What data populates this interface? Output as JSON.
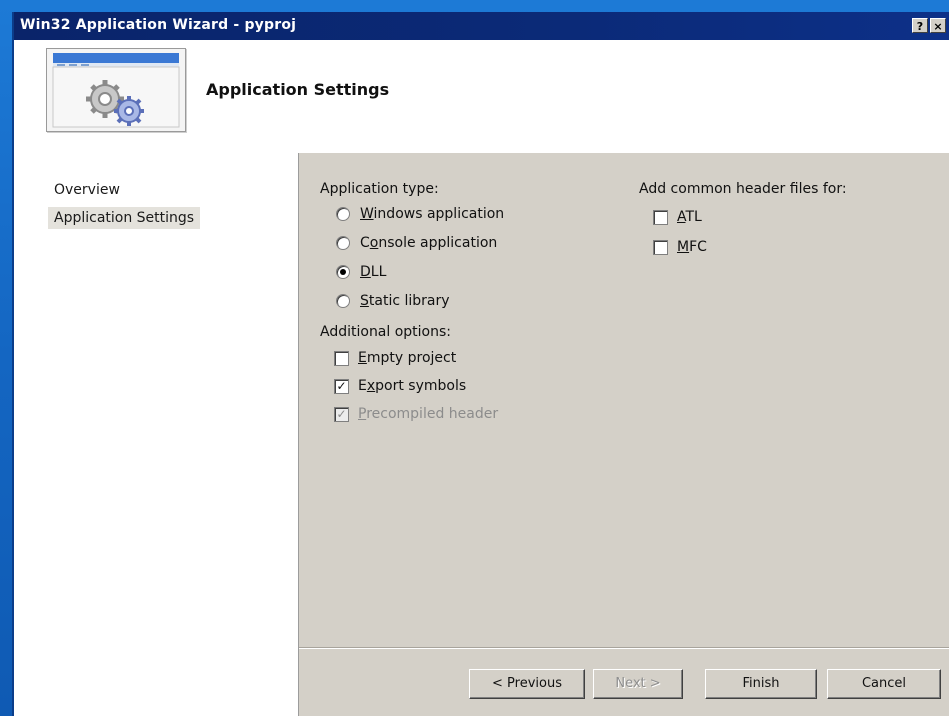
{
  "window": {
    "title": "Win32 Application Wizard - pyproj",
    "help_label": "?",
    "close_label": "×"
  },
  "header": {
    "title": "Application Settings",
    "icon": "gears-icon"
  },
  "nav": {
    "items": [
      {
        "label": "Overview",
        "selected": false
      },
      {
        "label": "Application Settings",
        "selected": true
      }
    ]
  },
  "application_type": {
    "label": "Application type:",
    "options": [
      {
        "label": "Windows application",
        "mnemonic": "W",
        "checked": false
      },
      {
        "label": "Console application",
        "mnemonic": "o",
        "checked": false
      },
      {
        "label": "DLL",
        "mnemonic": "D",
        "checked": true
      },
      {
        "label": "Static library",
        "mnemonic": "S",
        "checked": false
      }
    ]
  },
  "additional_options": {
    "label": "Additional options:",
    "options": [
      {
        "label": "Empty project",
        "checked": false,
        "enabled": true
      },
      {
        "label": "Export symbols",
        "checked": true,
        "enabled": true
      },
      {
        "label": "Precompiled header",
        "checked": true,
        "enabled": false
      }
    ]
  },
  "common_headers": {
    "label": "Add common header files for:",
    "options": [
      {
        "label": "ATL",
        "checked": false
      },
      {
        "label": "MFC",
        "checked": false
      }
    ]
  },
  "buttons": {
    "previous": "< Previous",
    "next": "Next >",
    "finish": "Finish",
    "cancel": "Cancel"
  },
  "colors": {
    "titlebar": "#0a246a",
    "dialog_face": "#d4d0c8",
    "desktop": "#1a6cc9"
  }
}
